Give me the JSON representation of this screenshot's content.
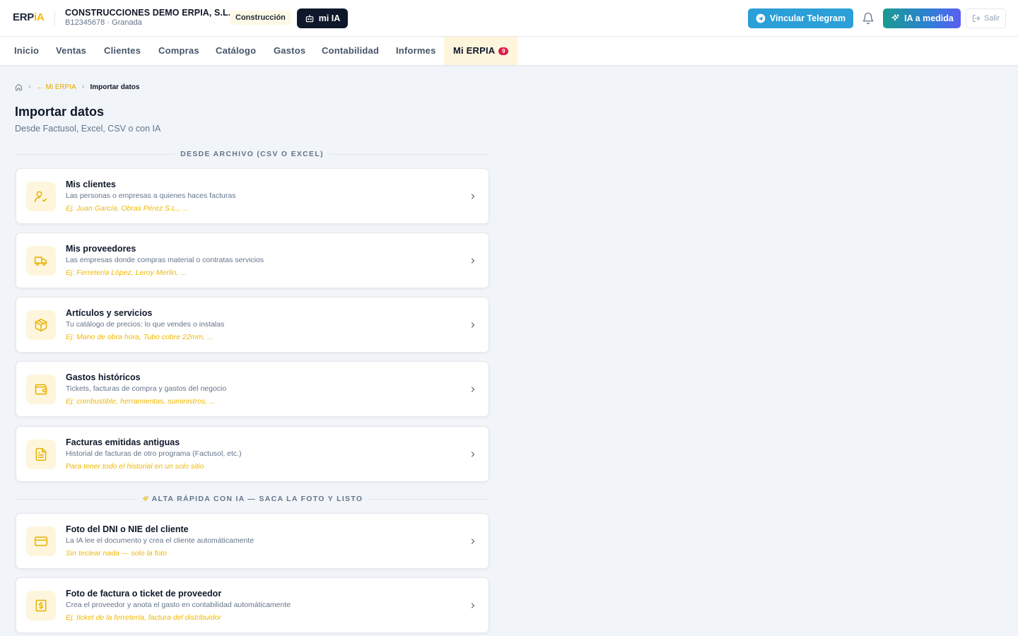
{
  "brand": {
    "logo_main": "ERP",
    "logo_accent": "iA",
    "accent_color": "#f5b800"
  },
  "company": {
    "name": "CONSTRUCCIONES DEMO ERPIA, S.L.",
    "meta": "B12345678 · Granada",
    "sector": "Construcción"
  },
  "header": {
    "mia_label": "mi IA",
    "telegram_label": "Vincular Telegram",
    "ia_label": "IA a medida",
    "exit_label": "Salir"
  },
  "nav": {
    "items": [
      {
        "label": "Inicio"
      },
      {
        "label": "Ventas"
      },
      {
        "label": "Clientes"
      },
      {
        "label": "Compras"
      },
      {
        "label": "Catálogo"
      },
      {
        "label": "Gastos"
      },
      {
        "label": "Contabilidad"
      },
      {
        "label": "Informes"
      },
      {
        "label": "Mi ERPIA",
        "badge": "9",
        "active": true
      }
    ]
  },
  "breadcrumb": {
    "parent": "← Mi ERPIA",
    "current": "Importar datos"
  },
  "page": {
    "title": "Importar datos",
    "subtitle": "Desde Factusol, Excel, CSV o con IA"
  },
  "sections": {
    "file": {
      "title": "DESDE ARCHIVO (CSV O EXCEL)"
    },
    "ai": {
      "title": "ALTA RÁPIDA CON IA — SACA LA FOTO Y LISTO"
    }
  },
  "cards": [
    {
      "icon": "user-check-icon",
      "title": "Mis clientes",
      "desc": "Las personas o empresas a quienes haces facturas",
      "example": "Ej: Juan García, Obras Pérez S.L., ..."
    },
    {
      "icon": "truck-icon",
      "title": "Mis proveedores",
      "desc": "Las empresas donde compras material o contratas servicios",
      "example": "Ej: Ferretería López, Leroy Merlin, ..."
    },
    {
      "icon": "package-icon",
      "title": "Artículos y servicios",
      "desc": "Tu catálogo de precios: lo que vendes o instalas",
      "example": "Ej: Mano de obra hora, Tubo cobre 22mm, ..."
    },
    {
      "icon": "wallet-icon",
      "title": "Gastos históricos",
      "desc": "Tickets, facturas de compra y gastos del negocio",
      "example": "Ej: combustible, herramientas, suministros, ..."
    },
    {
      "icon": "file-text-icon",
      "title": "Facturas emitidas antiguas",
      "desc": "Historial de facturas de otro programa (Factusol, etc.)",
      "example": "Para tener todo el historial en un solo sitio"
    },
    {
      "icon": "id-card-icon",
      "title": "Foto del DNI o NIE del cliente",
      "desc": "La IA lee el documento y crea el cliente automáticamente",
      "example": "Sin teclear nada — solo la foto"
    },
    {
      "icon": "receipt-icon",
      "title": "Foto de factura o ticket de proveedor",
      "desc": "Crea el proveedor y anota el gasto en contabilidad automáticamente",
      "example": "Ej: ticket de la ferretería, factura del distribuidor"
    }
  ]
}
